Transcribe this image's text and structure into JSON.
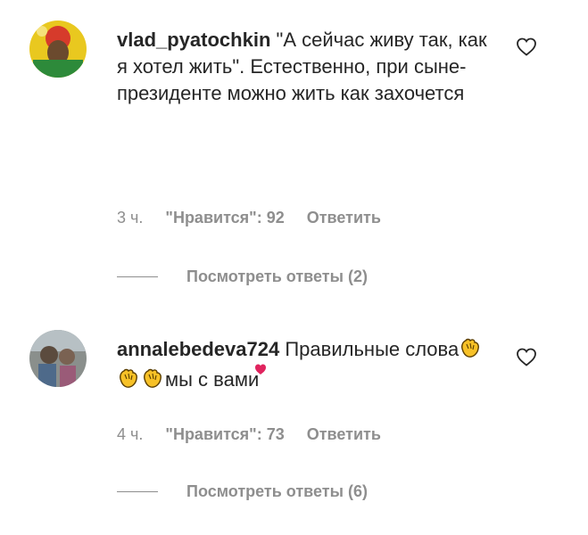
{
  "comments": [
    {
      "username": "vlad_pyatochkin",
      "text": "\"А сейчас живу так, как я хотел жить\". Естественно, при сыне-президенте можно жить как захочется",
      "time": "3 ч.",
      "likes": "\"Нравится\": 92",
      "reply_label": "Ответить",
      "view_replies": "Посмотреть ответы (2)",
      "like_icon": "heart-outline-icon"
    },
    {
      "username": "annalebedeva724",
      "text_part1": "Правильные слова",
      "text_part2": "мы с вами",
      "emojis": [
        "clapping-hands-emoji",
        "clapping-hands-emoji",
        "clapping-hands-emoji",
        "red-heart-emoji"
      ],
      "time": "4 ч.",
      "likes": "\"Нравится\": 73",
      "reply_label": "Ответить",
      "view_replies": "Посмотреть ответы (6)",
      "like_icon": "heart-outline-icon"
    }
  ],
  "colors": {
    "text": "#262626",
    "secondary": "#8e8e8e",
    "clap": "#f7c127",
    "heart_emoji": "#e0245e"
  }
}
